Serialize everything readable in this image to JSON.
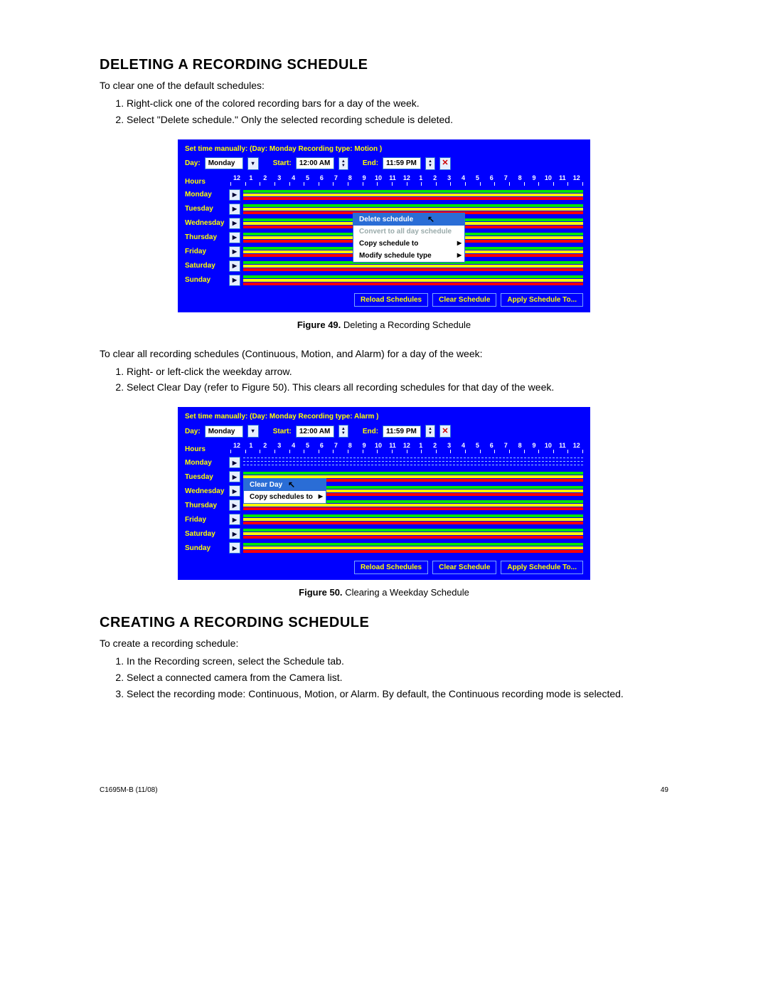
{
  "section1": {
    "title": "DELETING A RECORDING SCHEDULE",
    "intro": "To clear one of the default schedules:",
    "steps": [
      "Right-click one of the colored recording bars for a day of the week.",
      "Select \"Delete schedule.\" Only the selected recording schedule is deleted."
    ]
  },
  "fig49": {
    "caption_label": "Figure 49.",
    "caption_text": "Deleting a Recording Schedule",
    "header_line": "Set time manually: (Day:   Monday   Recording type:   Motion )",
    "day_label": "Day:",
    "day_value": "Monday",
    "start_label": "Start:",
    "start_value": "12:00 AM",
    "end_label": "End:",
    "end_value": "11:59 PM",
    "hours_label": "Hours",
    "days": [
      "Monday",
      "Tuesday",
      "Wednesday",
      "Thursday",
      "Friday",
      "Saturday",
      "Sunday"
    ],
    "hours": [
      "12",
      "1",
      "2",
      "3",
      "4",
      "5",
      "6",
      "7",
      "8",
      "9",
      "10",
      "11",
      "12",
      "1",
      "2",
      "3",
      "4",
      "5",
      "6",
      "7",
      "8",
      "9",
      "10",
      "11",
      "12"
    ],
    "context_menu": {
      "items": [
        {
          "label": "Delete schedule",
          "selected": true
        },
        {
          "label": "Convert to all day schedule",
          "disabled": true
        },
        {
          "label": "Copy schedule to",
          "submenu": true
        },
        {
          "label": "Modify schedule type",
          "submenu": true
        }
      ]
    },
    "buttons": {
      "reload": "Reload Schedules",
      "clear": "Clear Schedule",
      "apply": "Apply Schedule To..."
    }
  },
  "between": {
    "intro": "To clear all recording schedules (Continuous, Motion, and Alarm) for a day of the week:",
    "steps": [
      "Right- or left-click the weekday arrow.",
      "Select Clear Day (refer to Figure 50). This clears all recording schedules for that day of the week."
    ]
  },
  "fig50": {
    "caption_label": "Figure 50.",
    "caption_text": "Clearing a Weekday Schedule",
    "header_line": "Set time manually: (Day:   Monday   Recording type:   Alarm )",
    "day_label": "Day:",
    "day_value": "Monday",
    "start_label": "Start:",
    "start_value": "12:00 AM",
    "end_label": "End:",
    "end_value": "11:59 PM",
    "hours_label": "Hours",
    "days": [
      "Monday",
      "Tuesday",
      "Wednesday",
      "Thursday",
      "Friday",
      "Saturday",
      "Sunday"
    ],
    "hours": [
      "12",
      "1",
      "2",
      "3",
      "4",
      "5",
      "6",
      "7",
      "8",
      "9",
      "10",
      "11",
      "12",
      "1",
      "2",
      "3",
      "4",
      "5",
      "6",
      "7",
      "8",
      "9",
      "10",
      "11",
      "12"
    ],
    "context_menu": {
      "items": [
        {
          "label": "Clear Day",
          "selected": true
        },
        {
          "label": "Copy schedules to",
          "submenu": true
        }
      ]
    },
    "buttons": {
      "reload": "Reload Schedules",
      "clear": "Clear Schedule",
      "apply": "Apply Schedule To..."
    }
  },
  "section2": {
    "title": "CREATING A RECORDING SCHEDULE",
    "intro": "To create a recording schedule:",
    "steps": [
      "In the Recording screen, select the Schedule tab.",
      "Select a connected camera from the Camera list.",
      "Select the recording mode: Continuous, Motion, or Alarm. By default, the Continuous recording mode is selected."
    ]
  },
  "footer": {
    "left": "C1695M-B (11/08)",
    "right": "49"
  }
}
